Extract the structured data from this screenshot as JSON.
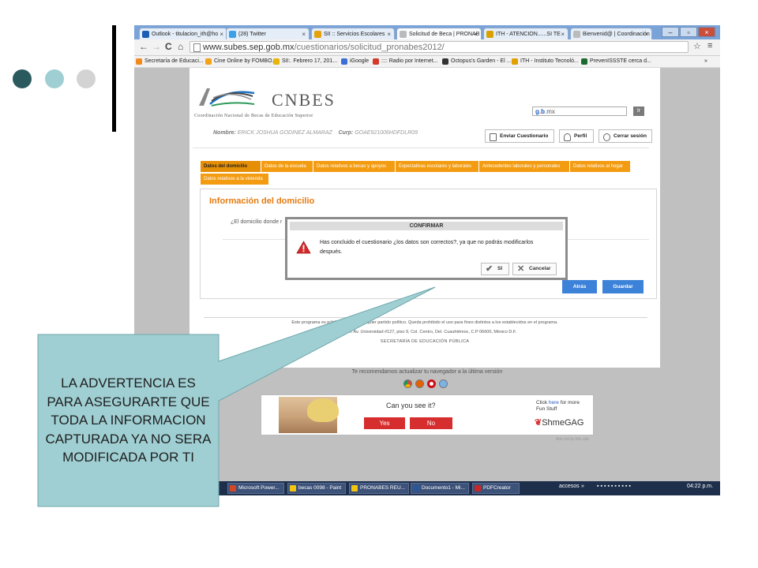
{
  "colors": {
    "dot1": "#2b5a5e",
    "dot2": "#9fcfd3",
    "dot3": "#d3d3d3",
    "accent_orange": "#f39c12",
    "title_orange": "#e47a10",
    "button_blue": "#3d82d9",
    "callout_fill": "#9fcfd3"
  },
  "browser": {
    "tabs": [
      {
        "label": "Outlook - titulacion_ith@ho",
        "icon": "outlook-icon",
        "color": "#1a5fb4"
      },
      {
        "label": "(28) Twitter",
        "icon": "twitter-icon",
        "color": "#3ba0e6"
      },
      {
        "label": "SII :: Servicios Escolares",
        "icon": "sii-icon",
        "color": "#e5a20c"
      },
      {
        "label": "Solicitud de Beca | PRONAB",
        "icon": "page-icon",
        "color": "#bbbbbb"
      },
      {
        "label": "ITH - ATENCION......SI TE",
        "icon": "ith-icon",
        "color": "#d9a100"
      },
      {
        "label": "Bienvenid@ | Coordinación",
        "icon": "page-icon",
        "color": "#bbbbbb"
      }
    ],
    "close_glyph": "×",
    "url_host": "www.subes.sep.gob.mx",
    "url_path": "/cuestionarios/solicitud_pronabes2012/",
    "bookmarks": [
      {
        "label": "Secretaría de Educaci...",
        "color": "#f28a1b"
      },
      {
        "label": "Cine Online by FOMBO...",
        "color": "#f2a21b"
      },
      {
        "label": "SII:. Febrero 17, 201...",
        "color": "#e5b50c"
      },
      {
        "label": "iGoogle",
        "color": "#3b6fd6"
      },
      {
        "label": ":::: Radio por Internet...",
        "color": "#d33a2c"
      },
      {
        "label": "Octopus's Garden - El ...",
        "color": "#333333"
      },
      {
        "label": "ITH - Instituto Tecnoló...",
        "color": "#e0a000"
      },
      {
        "label": "PrevenISSSTE cerca d...",
        "color": "#1b6b2e"
      }
    ],
    "bookmarks_more": "»"
  },
  "site": {
    "logo_text": "CNBES",
    "logo_sub": "Coordinación Nacional de Becas de Educación Superior",
    "search_g1": "g",
    "search_dot": ".",
    "search_g2": "b",
    "search_suffix": ".mx",
    "search_button": "Ir",
    "name_label": "Nombre:",
    "name_value": "ERICK JOSHUA GODINEZ ALMARAZ",
    "curp_label": "Curp:",
    "curp_value": "GOAE921006HDFDLR09",
    "header_buttons": [
      "Enviar Cuestionario",
      "Perfil",
      "Cerrar sesión"
    ],
    "tabs": [
      "Datos del domicilio",
      "Datos de la escuela",
      "Datos relativos a becas y apoyos",
      "Expectativas escolares y laborales",
      "Antecedentes laborales y personales",
      "Datos relativos al hogar",
      "Datos relativos a la vivienda"
    ],
    "section_title": "Información del domicilio",
    "question": "¿El domicilio donde r",
    "back_button": "Atrás",
    "save_button": "Guardar",
    "footer1": "Este programa es público, ajeno a cualquier partido político. Queda prohibido el uso para fines distintos a los establecidos en el programa.",
    "footer2": "Dirección: Av. Universidad #127, piso 9, Col. Centro, Del. Cuauhtémoc, C.P 06600, México D.F.",
    "footer3": "SECRETARÍA DE EDUCACIÓN PÚBLICA",
    "recommend": "Te recomendamos actualizar tu navegador a la última versión",
    "ad_question": "Can you see it?",
    "ad_yes": "Yes",
    "ad_no": "No",
    "ad_click_pre": "Click",
    "ad_click_here": "here",
    "ad_click_post": "for more",
    "ad_click_line2": "Fun Stuff",
    "ad_brand": "ShmeGAG",
    "ads_by": "Ads not by this site"
  },
  "modal": {
    "title": "CONFIRMAR",
    "message": "Has concluido el cuestionario ¿los datos son correctos?, ya que no podrás modificarlos después.",
    "yes": "SI",
    "cancel": "Cancelar"
  },
  "taskbar": {
    "items": [
      {
        "label": "Microsoft Power...",
        "color": "#d24726"
      },
      {
        "label": "becas 0098 - Paint",
        "color": "#f2c511"
      },
      {
        "label": "PRONABES REU...",
        "color": "#f2c511"
      },
      {
        "label": "Documento1 - Mi...",
        "color": "#2b579a"
      },
      {
        "label": "PDFCreator",
        "color": "#c62828"
      }
    ],
    "accesos": "accesos",
    "more": "»",
    "time": "04:22 p.m."
  },
  "callout": {
    "text": "LA ADVERTENCIA ES PARA ASEGURARTE QUE TODA LA INFORMACION CAPTURADA YA NO SERA MODIFICADA POR TI"
  }
}
